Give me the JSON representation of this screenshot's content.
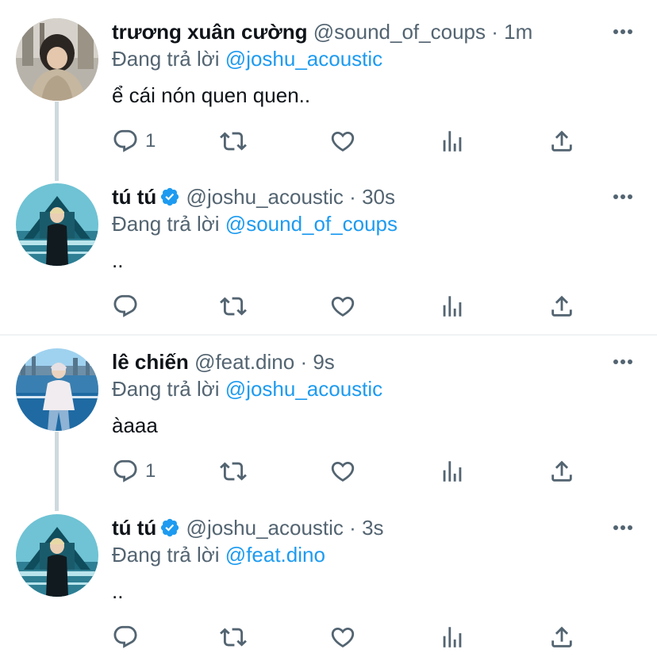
{
  "colors": {
    "link": "#1d9bf0",
    "muted": "#536471",
    "thread_line": "#cfd9de",
    "verified": "#1d9bf0"
  },
  "tweets": [
    {
      "name": "trương xuân cường",
      "handle": "@sound_of_coups",
      "dot": "·",
      "time": "1m",
      "reply_prefix": "Đang trả lời",
      "reply_to": "@joshu_acoustic",
      "text": "ể cái nón quen quen..",
      "reply_count": "1",
      "verified": false,
      "avatar": "avatar-hooded-person"
    },
    {
      "name": "tú tú",
      "handle": "@joshu_acoustic",
      "dot": "·",
      "time": "30s",
      "reply_prefix": "Đang trả lời",
      "reply_to": "@sound_of_coups",
      "text": "..",
      "reply_count": "",
      "verified": true,
      "avatar": "avatar-person-teal-building"
    },
    {
      "name": "lê chiến",
      "handle": "@feat.dino",
      "dot": "·",
      "time": "9s",
      "reply_prefix": "Đang trả lời",
      "reply_to": "@joshu_acoustic",
      "text": "àaaa",
      "reply_count": "1",
      "verified": false,
      "avatar": "avatar-person-waterfront"
    },
    {
      "name": "tú tú",
      "handle": "@joshu_acoustic",
      "dot": "·",
      "time": "3s",
      "reply_prefix": "Đang trả lời",
      "reply_to": "@feat.dino",
      "text": "..",
      "reply_count": "",
      "verified": true,
      "avatar": "avatar-person-teal-building"
    }
  ],
  "icons": [
    "reply-icon",
    "retweet-icon",
    "like-icon",
    "analytics-icon",
    "share-icon",
    "more-icon",
    "verified-badge-icon"
  ]
}
